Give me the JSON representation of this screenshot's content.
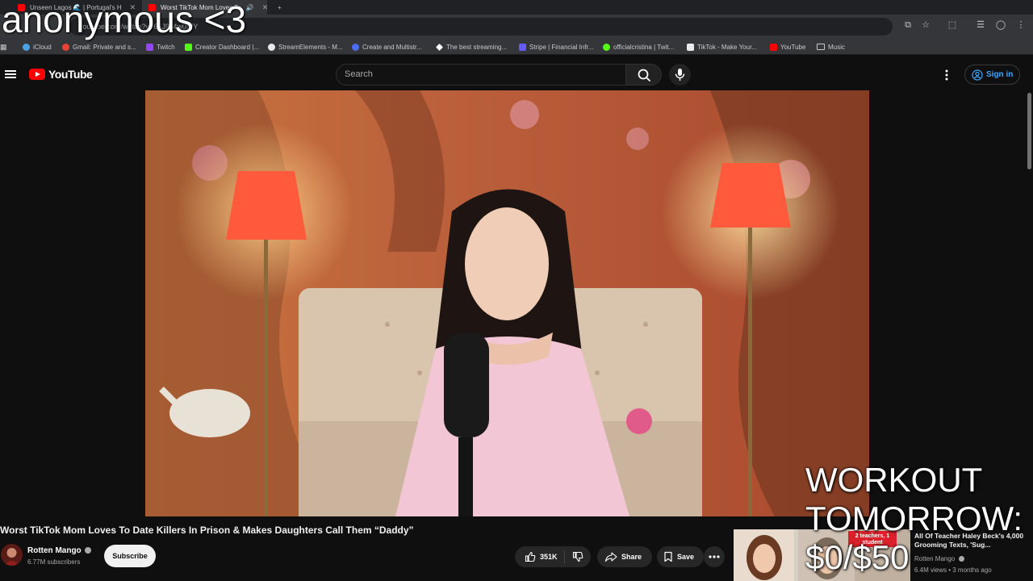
{
  "browser": {
    "tabs": [
      {
        "label": "Unseen Lagos 🌊 | Portugal's H",
        "active": false
      },
      {
        "label": "Worst TikTok Mom Loves To",
        "active": true
      }
    ],
    "new_tab": "+",
    "close": "✕",
    "url": "youtube.com/watch?v=65J9J4w0SfY",
    "bookmarks": [
      {
        "label": "iCloud",
        "color": "#4aa3df"
      },
      {
        "label": "Gmail: Private and s...",
        "color": "#ea4335"
      },
      {
        "label": "Twitch",
        "color": "#9146ff"
      },
      {
        "label": "Creator Dashboard |...",
        "color": "#53fc18"
      },
      {
        "label": "StreamElements - M...",
        "color": "#e8eaed"
      },
      {
        "label": "Create and Multistr...",
        "color": "#4b6cf7"
      },
      {
        "label": "The best streaming...",
        "color": "#ffffff"
      },
      {
        "label": "Stripe | Financial Infr...",
        "color": "#635bff"
      },
      {
        "label": "officialcristina | Twit...",
        "color": "#53fc18"
      },
      {
        "label": "TikTok - Make Your...",
        "color": "#e8eaed"
      },
      {
        "label": "YouTube",
        "color": "#ff0000"
      },
      {
        "label": "Music",
        "color": "#c8cacd"
      }
    ]
  },
  "overlay": {
    "top_text": "anonymous <3",
    "goal_line1": "WORKOUT",
    "goal_line2": "TOMORROW:",
    "goal_line3": "$0/$50"
  },
  "youtube": {
    "logo_text": "YouTube",
    "search_placeholder": "Search",
    "sign_in": "Sign in"
  },
  "video": {
    "title": "Worst TikTok Mom Loves To Date Killers In Prison & Makes Daughters Call Them “Daddy”",
    "channel": "Rotten Mango",
    "subscribers": "6.77M subscribers",
    "subscribe_label": "Subscribe",
    "likes": "351K",
    "share_label": "Share",
    "save_label": "Save"
  },
  "recommended": {
    "title": "All Of Teacher Haley Beck's 4,000 Grooming Texts, 'Sug...",
    "channel": "Rotten Mango",
    "meta": "6.4M views • 3 months ago",
    "thumb_text": "2 teachers, 1 student"
  },
  "colors": {
    "accent_red": "#ff0000",
    "link_blue": "#3ea6ff",
    "background": "#0f0f0f"
  }
}
